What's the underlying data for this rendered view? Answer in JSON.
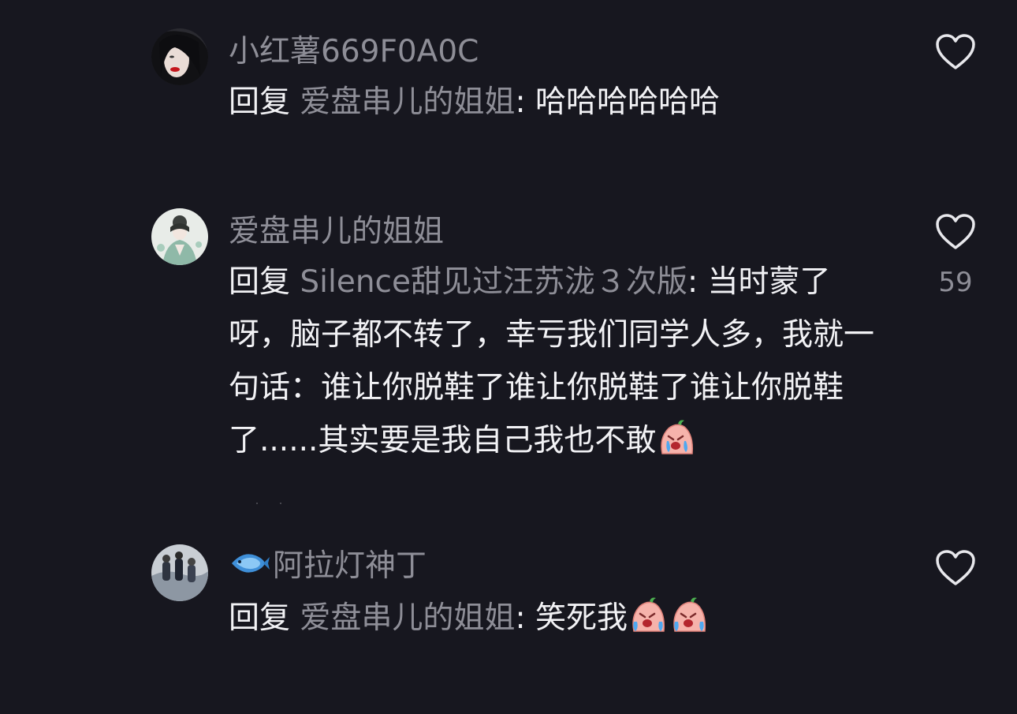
{
  "colors": {
    "background": "#17171f",
    "username": "#8e8e97",
    "text": "#f2f2f5",
    "icon": "#e8e8ec"
  },
  "comments": [
    {
      "avatar_icon": "avatar-photo-woman-red-lips",
      "username": "小红薯669F0A0C",
      "reply_prefix": "回复",
      "reply_target": "爱盘串儿的姐姐",
      "colon": ":",
      "text": "哈哈哈哈哈哈",
      "like_count": ""
    },
    {
      "avatar_icon": "avatar-illustration-girl",
      "username": "爱盘串儿的姐姐",
      "reply_prefix": "回复",
      "reply_target": "Silence甜见过汪苏泷３次版",
      "colon": ":",
      "text": "当时蒙了呀，脑子都不转了，幸亏我们同学人多，我就一句话：谁让你脱鞋了谁让你脱鞋了谁让你脱鞋了......其实要是我自己我也不敢",
      "like_count": "59"
    },
    {
      "avatar_icon": "avatar-photo-group",
      "username_prefix_icon": "fish-icon",
      "username": "阿拉灯神丁",
      "reply_prefix": "回复",
      "reply_target": "爱盘串儿的姐姐",
      "colon": ":",
      "text": "笑死我",
      "like_count": ""
    }
  ]
}
